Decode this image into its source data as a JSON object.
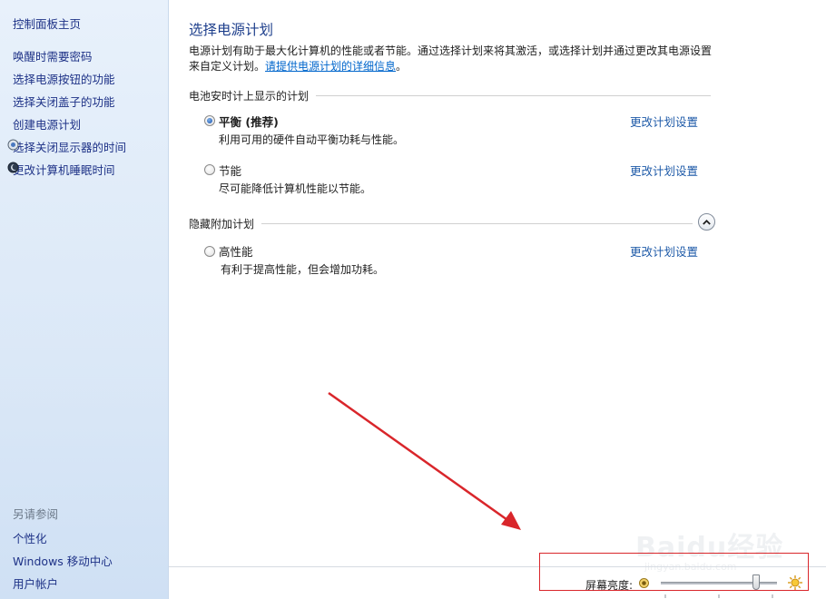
{
  "sidebar": {
    "home": "控制面板主页",
    "tasks": [
      {
        "label": "唤醒时需要密码",
        "icon": ""
      },
      {
        "label": "选择电源按钮的功能",
        "icon": ""
      },
      {
        "label": "选择关闭盖子的功能",
        "icon": ""
      },
      {
        "label": "创建电源计划",
        "icon": ""
      },
      {
        "label": "选择关闭显示器的时间",
        "icon": "display-shield-icon"
      },
      {
        "label": "更改计算机睡眠时间",
        "icon": "moon-icon"
      }
    ],
    "see_also_title": "另请参阅",
    "see_also": [
      "个性化",
      "Windows 移动中心",
      "用户帐户"
    ]
  },
  "main": {
    "title": "选择电源计划",
    "description": "电源计划有助于最大化计算机的性能或者节能。通过选择计划来将其激活，或选择计划并通过更改其电源设置来自定义计划。",
    "description_link": "请提供电源计划的详细信息",
    "description_end": "。",
    "battery_group_title": "电池安时计上显示的计划",
    "hidden_group_title": "隐藏附加计划",
    "plans": [
      {
        "name": "平衡 (推荐)",
        "desc": "利用可用的硬件自动平衡功耗与性能。",
        "link": "更改计划设置",
        "selected": true
      },
      {
        "name": "节能",
        "desc": "尽可能降低计算机性能以节能。",
        "link": "更改计划设置",
        "selected": false
      },
      {
        "name": "高性能",
        "desc": "有利于提高性能，但会增加功耗。",
        "link": "更改计划设置",
        "selected": false
      }
    ]
  },
  "bottom": {
    "brightness_label": "屏幕亮度:",
    "brightness_level": 0.82
  },
  "watermark": {
    "text": "Baidu经验",
    "sub": "jingyan.baidu.com"
  },
  "colors": {
    "annotation": "#d9262b",
    "link": "#1e5aa8",
    "title": "#1e3f8c"
  }
}
